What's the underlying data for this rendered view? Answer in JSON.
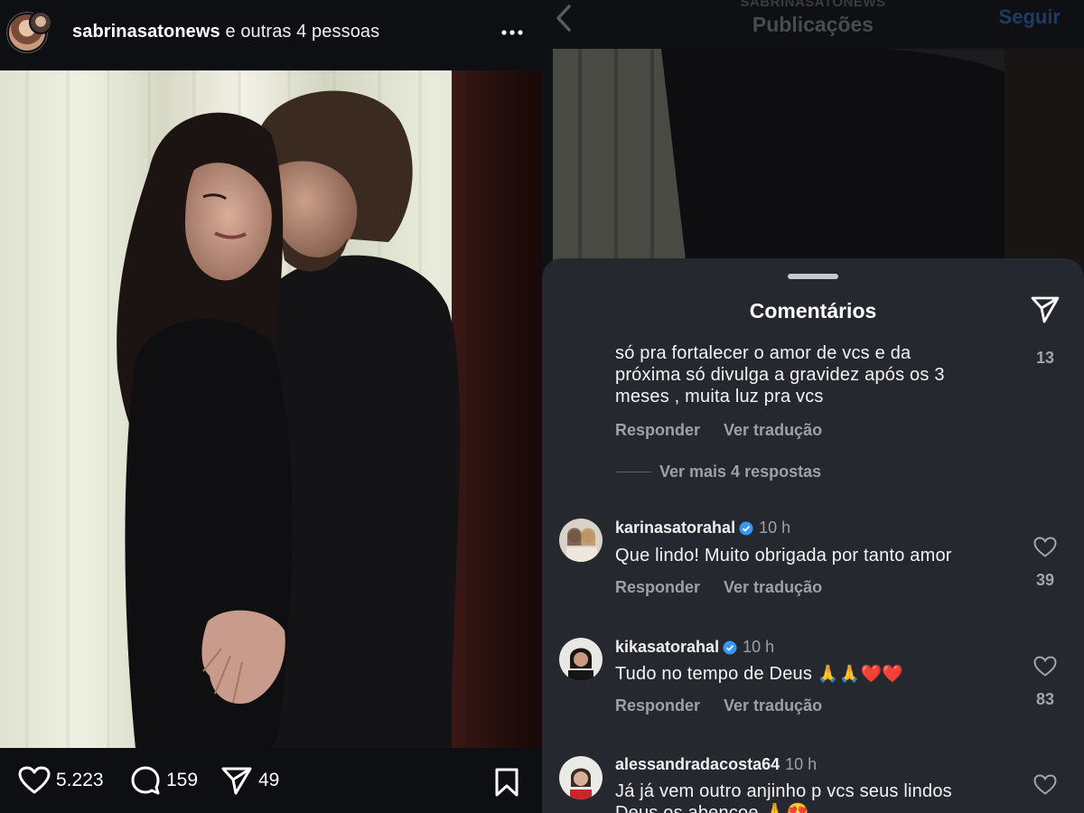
{
  "left": {
    "header": {
      "username": "sabrinasatonews",
      "rest": " e outras 4 pessoas"
    },
    "actions": {
      "likes": "5.223",
      "comments": "159",
      "shares": "49"
    }
  },
  "right": {
    "header": {
      "subtitle": "SABRINASATONEWS",
      "title": "Publicações",
      "follow": "Seguir"
    },
    "sheet": {
      "title": "Comentários",
      "comments": [
        {
          "lines": [
            "só pra fortalecer o amor de vcs e da",
            "próxima só divulga a gravidez após os 3",
            "meses , muita luz pra vcs"
          ],
          "reply": "Responder",
          "translate": "Ver tradução",
          "likes": "13"
        },
        {
          "username": "karinasatorahal",
          "time": "10 h",
          "text": "Que lindo! Muito obrigada por tanto amor",
          "reply": "Responder",
          "translate": "Ver tradução",
          "likes": "39"
        },
        {
          "username": "kikasatorahal",
          "time": "10 h",
          "text": "Tudo no tempo de Deus",
          "emoji": "🙏🙏❤️❤️",
          "reply": "Responder",
          "translate": "Ver tradução",
          "likes": "83"
        },
        {
          "username": "alessandradacosta64",
          "time": "10 h",
          "line1": "Já já vem outro anjinho p vcs seus lindos",
          "line2": "Deus os abençoe 🙏😍"
        }
      ],
      "more_replies": "Ver mais 4 respostas"
    }
  },
  "colors": {
    "sheet_bg": "#25282e",
    "muted_text": "#9ea0a5",
    "verified": "#3897f0",
    "follow": "#1d3c63"
  }
}
